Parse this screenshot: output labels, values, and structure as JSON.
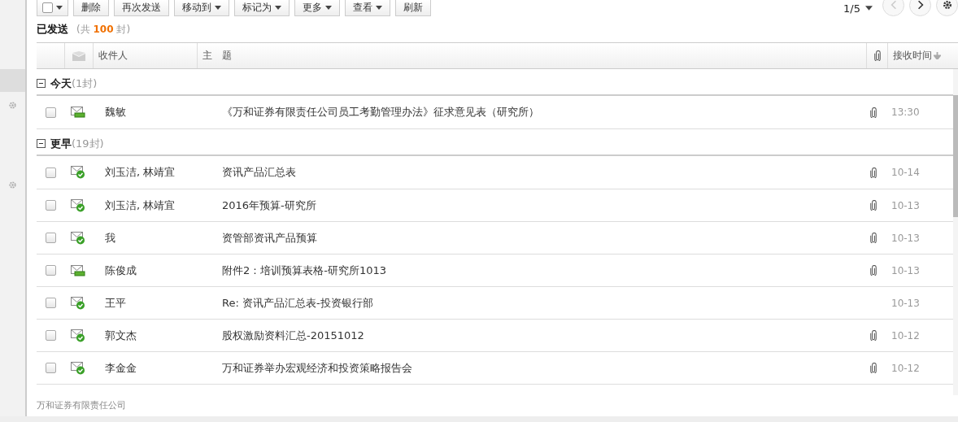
{
  "toolbar": {
    "buttons": [
      {
        "label": "删除",
        "dropdown": false
      },
      {
        "label": "再次发送",
        "dropdown": false
      },
      {
        "label": "移动到",
        "dropdown": true
      },
      {
        "label": "标记为",
        "dropdown": true
      },
      {
        "label": "更多",
        "dropdown": true
      },
      {
        "label": "查看",
        "dropdown": true
      },
      {
        "label": "刷新",
        "dropdown": false
      }
    ],
    "pager": "1/5"
  },
  "folder": {
    "title": "已发送",
    "count_prefix": "(共",
    "count": "100",
    "count_suffix": "封)"
  },
  "table": {
    "columns": [
      "收件人",
      "主　题",
      "接收时间"
    ],
    "groups": [
      {
        "label": "今天",
        "count": "(1封)",
        "expanded": true,
        "rows": [
          {
            "kind": "sent",
            "recipient": "魏敏",
            "subject": "《万和证券有限责任公司员工考勤管理办法》征求意见表（研究所）",
            "attachment": true,
            "time": "13:30",
            "checked": false
          }
        ]
      },
      {
        "label": "更早",
        "count": "(19封)",
        "expanded": true,
        "rows": [
          {
            "kind": "delivered",
            "recipient": "刘玉洁, 林靖宜",
            "subject": "资讯产品汇总表",
            "attachment": true,
            "time": "10-14",
            "checked": false
          },
          {
            "kind": "delivered",
            "recipient": "刘玉洁, 林靖宜",
            "subject": "2016年预算-研究所",
            "attachment": true,
            "time": "10-13",
            "checked": false
          },
          {
            "kind": "delivered",
            "recipient": "我",
            "subject": "资管部资讯产品预算",
            "attachment": true,
            "time": "10-13",
            "checked": false
          },
          {
            "kind": "sent",
            "recipient": "陈俊成",
            "subject": "附件2：培训预算表格-研究所1013",
            "attachment": true,
            "time": "10-13",
            "checked": false
          },
          {
            "kind": "delivered",
            "recipient": "王平",
            "subject": "Re: 资讯产品汇总表-投资银行部",
            "attachment": false,
            "time": "10-13",
            "checked": false
          },
          {
            "kind": "delivered",
            "recipient": "郭文杰",
            "subject": "股权激励资料汇总-20151012",
            "attachment": true,
            "time": "10-12",
            "checked": false
          },
          {
            "kind": "delivered",
            "recipient": "李金金",
            "subject": "万和证券举办宏观经济和投资策略报告会",
            "attachment": true,
            "time": "10-12",
            "checked": false
          }
        ]
      }
    ]
  },
  "footer": "万和证券有限责任公司"
}
